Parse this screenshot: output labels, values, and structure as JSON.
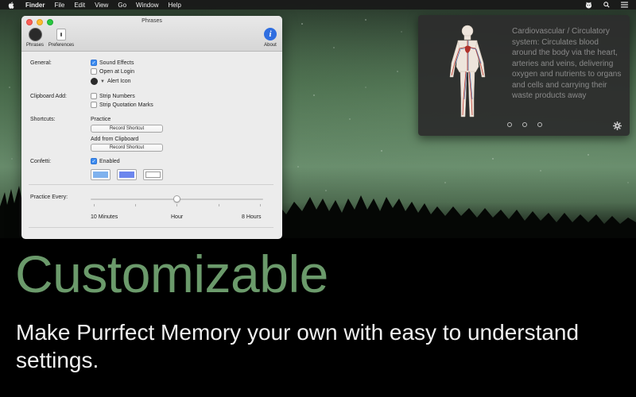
{
  "menubar": {
    "items": [
      "Finder",
      "File",
      "Edit",
      "View",
      "Go",
      "Window",
      "Help"
    ]
  },
  "window": {
    "title": "Phrases",
    "toolbar": {
      "phrases_label": "Phrases",
      "preferences_label": "Preferences",
      "about_label": "About"
    },
    "general": {
      "label": "General:",
      "sound_effects": {
        "label": "Sound Effects",
        "checked": true
      },
      "open_at_login": {
        "label": "Open at Login",
        "checked": false
      },
      "alert_icon_label": "Alert Icon"
    },
    "clipboard": {
      "label": "Clipboard Add:",
      "strip_numbers": {
        "label": "Strip Numbers",
        "checked": false
      },
      "strip_quotation_marks": {
        "label": "Strip Quotation Marks",
        "checked": false
      }
    },
    "shortcuts": {
      "label": "Shortcuts:",
      "practice_label": "Practice",
      "practice_button": "Record Shortcut",
      "add_label": "Add from Clipboard",
      "add_button": "Record Shortcut"
    },
    "confetti": {
      "label": "Confetti:",
      "enabled": {
        "label": "Enabled",
        "checked": true
      },
      "colors": [
        "#7fb2ee",
        "#6c86ee",
        "#ffffff"
      ]
    },
    "practice": {
      "label": "Practice Every:",
      "min_label": "10 Minutes",
      "mid_label": "Hour",
      "max_label": "8 Hours",
      "value_fraction": 0.5
    }
  },
  "card": {
    "text": "Cardiovascular / Circulatory system: Circulates blood around the body via the heart, arteries and veins, delivering oxygen and nutrients to organs and cells and carrying their waste products away",
    "page_count": 3
  },
  "marketing": {
    "headline": "Customizable",
    "subline": "Make Purrfect Memory your own with easy to understand settings."
  },
  "colors": {
    "headline": "#6b9a6b",
    "accent_blue": "#3d8cf0"
  }
}
